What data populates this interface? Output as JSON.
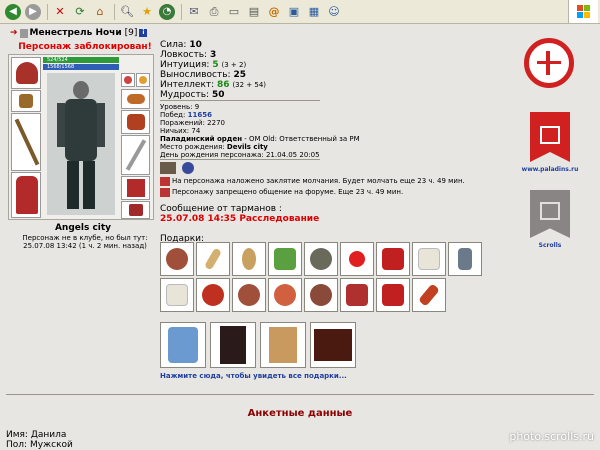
{
  "toolbar": {
    "icons": [
      "back-icon",
      "forward-icon",
      "stop-icon",
      "refresh-icon",
      "home-icon",
      "search-icon",
      "favorites-icon",
      "history-icon",
      "mail-icon",
      "print-icon",
      "edit-icon",
      "discuss-icon",
      "at-icon",
      "messenger-icon",
      "research-icon",
      "users-icon"
    ]
  },
  "character": {
    "name": "Менестрель Ночи",
    "level": "[9]",
    "info_badge": "i",
    "blocked": "Персонаж заблокирован!",
    "hp": "524/524",
    "mp": "1568/1568",
    "city": "Angels city",
    "not_in_club": "Персонаж не в клубе, но был тут:",
    "last_seen": "25.07.08 13:42 (1 ч. 2 мин. назад)"
  },
  "stats": {
    "strength_label": "Сила:",
    "strength": "10",
    "agility_label": "Ловкость:",
    "agility": "3",
    "intuition_label": "Интуиция:",
    "intuition": "5",
    "intuition_bonus": "(3 + 2)",
    "endurance_label": "Выносливость:",
    "endurance": "25",
    "intellect_label": "Интеллект:",
    "intellect": "86",
    "intellect_bonus": "(32 + 54)",
    "wisdom_label": "Мудрость:",
    "wisdom": "50"
  },
  "info": {
    "level_label": "Уровень:",
    "level": "9",
    "wins_label": "Побед:",
    "wins": "11656",
    "losses_label": "Поражений:",
    "losses": "2270",
    "draws_label": "Ничьих:",
    "draws": "74",
    "order": "Паладинский орден",
    "order_desc": " - OM Old: Ответственный за PM",
    "birthplace_label": "Место рождения:",
    "birthplace": "Devils city",
    "birthday_label": "День рождения персонажа:",
    "birthday": "21.04.05 20:05"
  },
  "notes": {
    "silence": "На персонажа наложено заклятие молчания. Будет молчать еще 23 ч. 49 мин.",
    "forum": "Персонажу запрещено общение на форуме. Еще 23 ч. 49 мин."
  },
  "message": {
    "title": "Сообщение от тарманов :",
    "text": "25.07.08 14:35 Расследование"
  },
  "gifts": {
    "title": "Подарки:",
    "link": "Нажмите сюда, чтобы увидеть все подарки..."
  },
  "emblems": {
    "paladins_url": "www.paladins.ru",
    "scrolls_label": "Scrolls"
  },
  "anketa": {
    "title": "Анкетные данные",
    "name_label": "Имя:",
    "name": "Данила",
    "sex_label": "Пол:",
    "sex": "Мужской"
  },
  "watermark": "photo.scrolls.ru",
  "colors": {
    "accent_red": "#d00000",
    "link_blue": "#1f3f9f",
    "stat_green": "#1b8a1b",
    "background": "#e8e6e2"
  }
}
